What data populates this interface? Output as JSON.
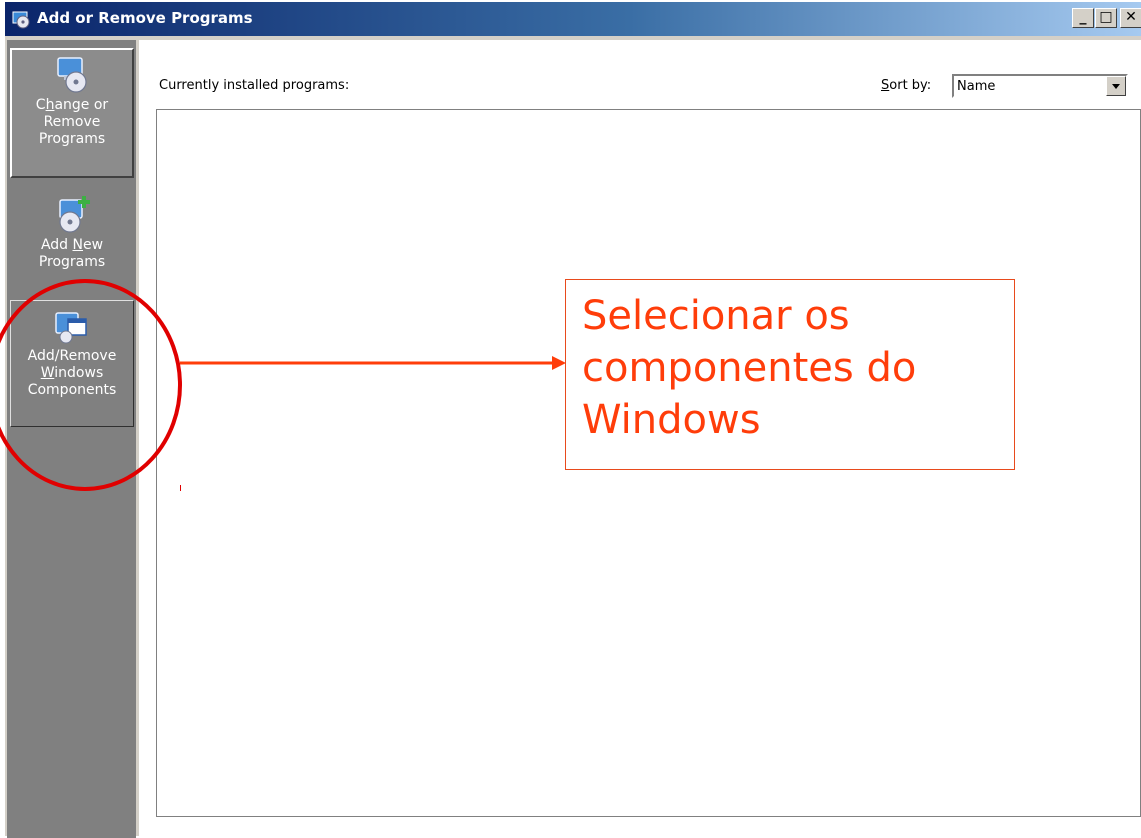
{
  "window": {
    "title": "Add or Remove Programs",
    "controls": {
      "minimize": "_",
      "maximize": "□",
      "close": "✕"
    }
  },
  "sidebar": {
    "items": [
      {
        "line1_pre": "C",
        "line1_u": "h",
        "line1_post": "ange or",
        "line2": "Remove",
        "line3": "Programs",
        "icon": "cd-computer-icon"
      },
      {
        "line1_pre": "Add ",
        "line1_u": "N",
        "line1_post": "ew",
        "line2": "Programs",
        "icon": "add-cd-icon"
      },
      {
        "line1": "Add/Remove",
        "line2_u": "W",
        "line2_post": "indows",
        "line3": "Components",
        "icon": "windows-components-icon"
      }
    ]
  },
  "main": {
    "installed_label": "Currently installed programs:",
    "sort_label_u": "S",
    "sort_label_post": "ort by:",
    "sort_value": "Name"
  },
  "annotation": {
    "callout_line1": "Selecionar os",
    "callout_line2": "componentes do",
    "callout_line3": "Windows",
    "color": "#ff3d0a"
  }
}
